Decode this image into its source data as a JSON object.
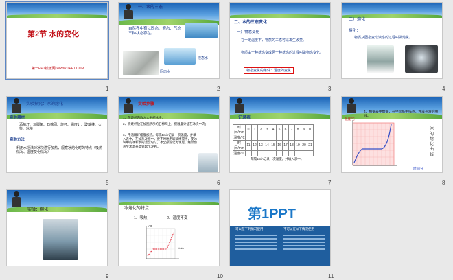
{
  "slides": [
    {
      "num": "1",
      "title": "第2节 水的变化",
      "footer": "第一PPT模板网-WWW.1PPT.COM"
    },
    {
      "num": "2",
      "heading": "一、水的三态",
      "body": "自然界中有以固态、液态、气态三种状态存在。",
      "label_liquid": "液态水",
      "label_solid": "固态水"
    },
    {
      "num": "3",
      "heading": "二、水的三态变化",
      "sub1": "一）物态变化",
      "body1": "在一定温度下，物质的三态可以发生改变。",
      "body2": "物质由一种状态变成另一种状态的过程叫做物态变化。",
      "box": "物态变化的条件：温度的变化"
    },
    {
      "num": "4",
      "heading": "二）熔化",
      "sub": "熔化：",
      "body": "物质从固态变成液态的过程叫做熔化。"
    },
    {
      "num": "5",
      "heading": "实验探究：冰的熔化",
      "sub1": "实验器材",
      "body1": "酒精灯、三脚架、石棉网、烧杯、温度计、玻璃棒、火柴、冰块",
      "sub2": "实验方法",
      "body2": "利用水浴法对冰块进行加热，观察冰熔化时的特点（吸热情况、温度变化情况）"
    },
    {
      "num": "6",
      "heading": "实验步骤",
      "s1": "1、在烧杯内放入大半杯冰块；",
      "s2": "2、将烧杯放在加图所示的石棉网上，把温度计插在冰块中央；",
      "s3": "3、用酒精灯缓慢加热。每隔1min记录一次温度，并填入表中，在加热过程中，要不时地用玻璃棒搅拌，使冰块中的冰和水的温度均匀。冰全部熔化为水后，继续加热至水温升高到10℃左右。"
    },
    {
      "num": "7",
      "heading": "记录表",
      "row1": "时间/min",
      "row2": "温度/℃",
      "row3": "时间/min",
      "row4": "温度/℃",
      "cols1": [
        "0",
        "1",
        "2",
        "3",
        "4",
        "5",
        "6",
        "7",
        "8",
        "9",
        "10"
      ],
      "cols2": [
        "11",
        "12",
        "13",
        "14",
        "15",
        "16",
        "17",
        "18",
        "19",
        "20",
        "21"
      ],
      "note": "每隔1min记录一次温度，并填入表中。"
    },
    {
      "num": "8",
      "heading": "4、根据表中数据，在坐标纸中描点，连成光滑的曲线。",
      "ylabel": "温度/℃",
      "xlabel": "时间/分",
      "side": "冰的熔化曲线",
      "ticks": [
        "5",
        "10"
      ],
      "yticks": [
        "5",
        "0",
        "-5",
        "-10"
      ]
    },
    {
      "num": "9",
      "heading": "实验：熔化"
    },
    {
      "num": "10",
      "heading": "冰熔化的特点：",
      "p1": "1、吸热",
      "p2": "2、温度不变",
      "ylabel": "t/℃",
      "xlabel": "t/min"
    },
    {
      "num": "11",
      "logo": "第1PPT",
      "footer_a": "可以在下列情况使用",
      "footer_b": "不可以在以下情况使用"
    }
  ]
}
